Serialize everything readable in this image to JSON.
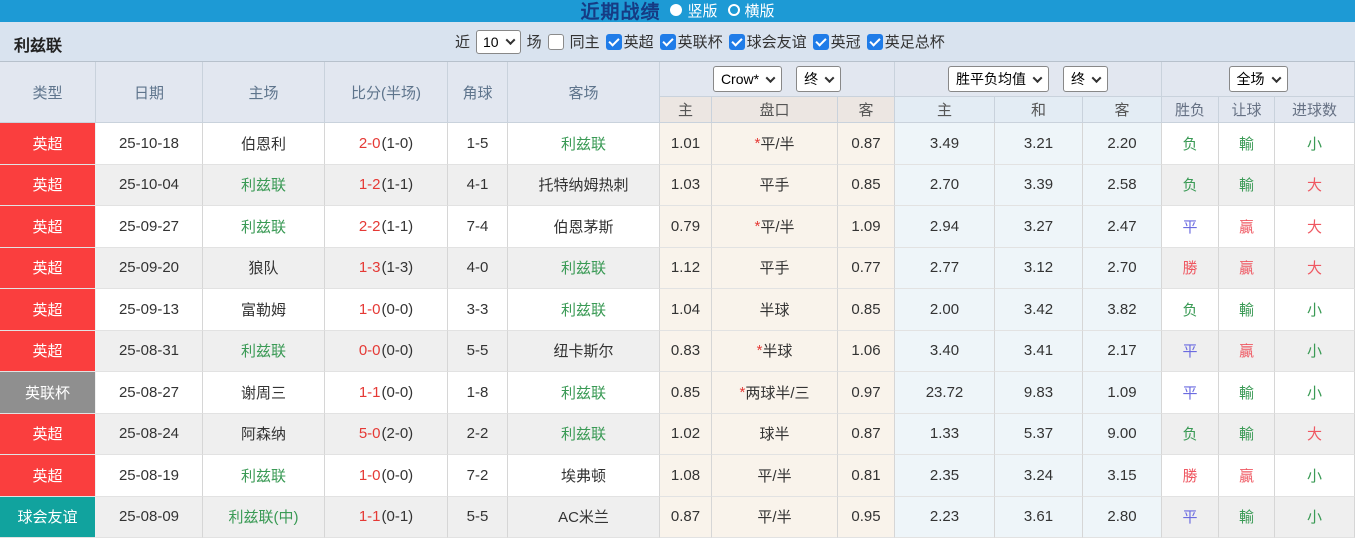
{
  "topbar": {
    "title": "近期战绩",
    "vertical_label": "竖版",
    "horizontal_label": "横版"
  },
  "filterbar": {
    "team": "利兹联",
    "near_label": "近",
    "matches_value": "10",
    "games_label": "场",
    "same_home_label": "同主",
    "leagues": [
      "英超",
      "英联杯",
      "球会友谊",
      "英冠",
      "英足总杯"
    ]
  },
  "table": {
    "dropdowns": {
      "bookmaker": "Crow*",
      "final1": "终",
      "avg_label": "胜平负均值",
      "final2": "终",
      "scope": "全场"
    },
    "headers": {
      "type": "类型",
      "date": "日期",
      "home": "主场",
      "score": "比分(半场)",
      "corner": "角球",
      "away": "客场",
      "odds_home": "主",
      "odds_handicap": "盘口",
      "odds_away": "客",
      "avg_home": "主",
      "avg_draw": "和",
      "avg_away": "客",
      "res_wdl": "胜负",
      "res_handicap": "让球",
      "res_goals": "进球数"
    },
    "rows": [
      {
        "type": "英超",
        "type_color": "red",
        "date": "25-10-18",
        "home": "伯恩利",
        "home_hl": false,
        "score_ft": "2-0",
        "score_ht": "(1-0)",
        "corner": "1-5",
        "away": "利兹联",
        "away_hl": true,
        "odds_home": "1.01",
        "handicap_star": "*",
        "handicap": "平/半",
        "odds_away": "0.87",
        "avg_home": "3.49",
        "avg_draw": "3.21",
        "avg_away": "2.20",
        "result_wdl": "负",
        "result_wdl_color": "green",
        "result_handicap": "輸",
        "result_handicap_color": "green",
        "result_goals": "小",
        "result_goals_color": "green"
      },
      {
        "type": "英超",
        "type_color": "red",
        "date": "25-10-04",
        "home": "利兹联",
        "home_hl": true,
        "score_ft": "1-2",
        "score_ht": "(1-1)",
        "corner": "4-1",
        "away": "托特纳姆热刺",
        "away_hl": false,
        "odds_home": "1.03",
        "handicap_star": "",
        "handicap": "平手",
        "odds_away": "0.85",
        "avg_home": "2.70",
        "avg_draw": "3.39",
        "avg_away": "2.58",
        "result_wdl": "负",
        "result_wdl_color": "green",
        "result_handicap": "輸",
        "result_handicap_color": "green",
        "result_goals": "大",
        "result_goals_color": "red"
      },
      {
        "type": "英超",
        "type_color": "red",
        "date": "25-09-27",
        "home": "利兹联",
        "home_hl": true,
        "score_ft": "2-2",
        "score_ht": "(1-1)",
        "corner": "7-4",
        "away": "伯恩茅斯",
        "away_hl": false,
        "odds_home": "0.79",
        "handicap_star": "*",
        "handicap": "平/半",
        "odds_away": "1.09",
        "avg_home": "2.94",
        "avg_draw": "3.27",
        "avg_away": "2.47",
        "result_wdl": "平",
        "result_wdl_color": "blue",
        "result_handicap": "贏",
        "result_handicap_color": "red",
        "result_goals": "大",
        "result_goals_color": "red"
      },
      {
        "type": "英超",
        "type_color": "red",
        "date": "25-09-20",
        "home": "狼队",
        "home_hl": false,
        "score_ft": "1-3",
        "score_ht": "(1-3)",
        "corner": "4-0",
        "away": "利兹联",
        "away_hl": true,
        "odds_home": "1.12",
        "handicap_star": "",
        "handicap": "平手",
        "odds_away": "0.77",
        "avg_home": "2.77",
        "avg_draw": "3.12",
        "avg_away": "2.70",
        "result_wdl": "勝",
        "result_wdl_color": "red",
        "result_handicap": "贏",
        "result_handicap_color": "red",
        "result_goals": "大",
        "result_goals_color": "red"
      },
      {
        "type": "英超",
        "type_color": "red",
        "date": "25-09-13",
        "home": "富勒姆",
        "home_hl": false,
        "score_ft": "1-0",
        "score_ht": "(0-0)",
        "corner": "3-3",
        "away": "利兹联",
        "away_hl": true,
        "odds_home": "1.04",
        "handicap_star": "",
        "handicap": "半球",
        "odds_away": "0.85",
        "avg_home": "2.00",
        "avg_draw": "3.42",
        "avg_away": "3.82",
        "result_wdl": "负",
        "result_wdl_color": "green",
        "result_handicap": "輸",
        "result_handicap_color": "green",
        "result_goals": "小",
        "result_goals_color": "green"
      },
      {
        "type": "英超",
        "type_color": "red",
        "date": "25-08-31",
        "home": "利兹联",
        "home_hl": true,
        "score_ft": "0-0",
        "score_ht": "(0-0)",
        "corner": "5-5",
        "away": "纽卡斯尔",
        "away_hl": false,
        "odds_home": "0.83",
        "handicap_star": "*",
        "handicap": "半球",
        "odds_away": "1.06",
        "avg_home": "3.40",
        "avg_draw": "3.41",
        "avg_away": "2.17",
        "result_wdl": "平",
        "result_wdl_color": "blue",
        "result_handicap": "贏",
        "result_handicap_color": "red",
        "result_goals": "小",
        "result_goals_color": "green"
      },
      {
        "type": "英联杯",
        "type_color": "gray",
        "date": "25-08-27",
        "home": "谢周三",
        "home_hl": false,
        "score_ft": "1-1",
        "score_ht": "(0-0)",
        "corner": "1-8",
        "away": "利兹联",
        "away_hl": true,
        "odds_home": "0.85",
        "handicap_star": "*",
        "handicap": "两球半/三",
        "odds_away": "0.97",
        "avg_home": "23.72",
        "avg_draw": "9.83",
        "avg_away": "1.09",
        "result_wdl": "平",
        "result_wdl_color": "blue",
        "result_handicap": "輸",
        "result_handicap_color": "green",
        "result_goals": "小",
        "result_goals_color": "green"
      },
      {
        "type": "英超",
        "type_color": "red",
        "date": "25-08-24",
        "home": "阿森纳",
        "home_hl": false,
        "score_ft": "5-0",
        "score_ht": "(2-0)",
        "corner": "2-2",
        "away": "利兹联",
        "away_hl": true,
        "odds_home": "1.02",
        "handicap_star": "",
        "handicap": "球半",
        "odds_away": "0.87",
        "avg_home": "1.33",
        "avg_draw": "5.37",
        "avg_away": "9.00",
        "result_wdl": "负",
        "result_wdl_color": "green",
        "result_handicap": "輸",
        "result_handicap_color": "green",
        "result_goals": "大",
        "result_goals_color": "red"
      },
      {
        "type": "英超",
        "type_color": "red",
        "date": "25-08-19",
        "home": "利兹联",
        "home_hl": true,
        "score_ft": "1-0",
        "score_ht": "(0-0)",
        "corner": "7-2",
        "away": "埃弗顿",
        "away_hl": false,
        "odds_home": "1.08",
        "handicap_star": "",
        "handicap": "平/半",
        "odds_away": "0.81",
        "avg_home": "2.35",
        "avg_draw": "3.24",
        "avg_away": "3.15",
        "result_wdl": "勝",
        "result_wdl_color": "red",
        "result_handicap": "贏",
        "result_handicap_color": "red",
        "result_goals": "小",
        "result_goals_color": "green"
      },
      {
        "type": "球会友谊",
        "type_color": "teal",
        "date": "25-08-09",
        "home": "利兹联(中)",
        "home_hl": true,
        "score_ft": "1-1",
        "score_ht": "(0-1)",
        "corner": "5-5",
        "away": "AC米兰",
        "away_hl": false,
        "odds_home": "0.87",
        "handicap_star": "",
        "handicap": "平/半",
        "odds_away": "0.95",
        "avg_home": "2.23",
        "avg_draw": "3.61",
        "avg_away": "2.80",
        "result_wdl": "平",
        "result_wdl_color": "blue",
        "result_handicap": "輸",
        "result_handicap_color": "green",
        "result_goals": "小",
        "result_goals_color": "green"
      }
    ]
  },
  "colors": {
    "topbar_blue": "#1d9ad5",
    "title_navy": "#163b84",
    "badge_red": "#fa3e3e",
    "badge_gray": "#8f8f8f",
    "badge_teal": "#11a39e",
    "team_green": "#3a9a55",
    "score_red": "#e53935",
    "result_green": "#3a9a55",
    "result_red": "#ef5862",
    "result_blue": "#6b6be0",
    "odds_col_bg": "#f9f3eb",
    "avg_col_bg": "#eef5f9"
  }
}
